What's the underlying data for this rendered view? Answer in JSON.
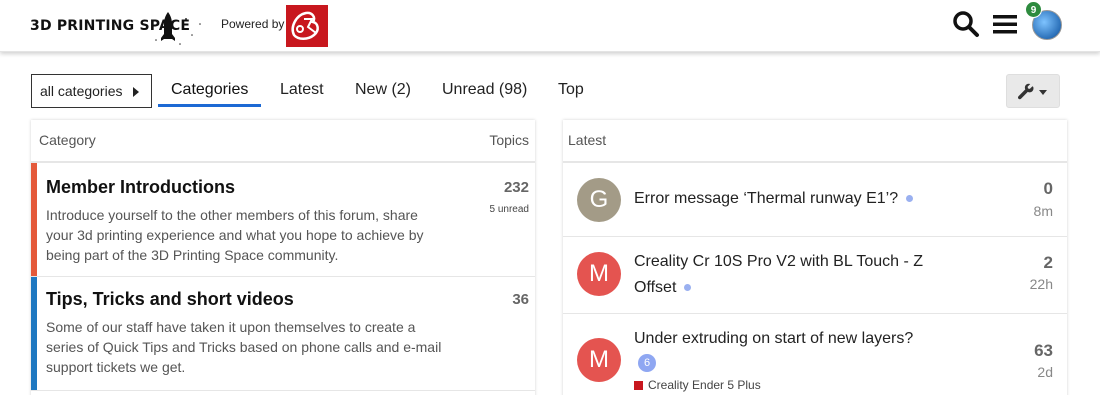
{
  "header": {
    "logo_text": "3D PRINTING SPACE",
    "powered_by": "Powered by",
    "notification_count": "9",
    "icons": [
      "search-icon",
      "hamburger-menu-icon",
      "user-avatar"
    ]
  },
  "nav": {
    "category_dropdown": "all categories",
    "tabs": [
      {
        "label": "Categories",
        "active": true
      },
      {
        "label": "Latest"
      },
      {
        "label": "New (2)"
      },
      {
        "label": "Unread (98)"
      },
      {
        "label": "Top"
      }
    ],
    "tools_button_icon": "wrench-icon"
  },
  "categories_panel": {
    "header_category": "Category",
    "header_topics": "Topics",
    "rows": [
      {
        "title": "Member Introductions",
        "description": "Introduce yourself to the other members of this forum, share your 3d printing experience and what you hope to achieve by being part of the 3D Printing Space community.",
        "topics": "232",
        "unread": "5 unread",
        "color": "#e4593a"
      },
      {
        "title": "Tips, Tricks and short videos",
        "description": "Some of our staff have taken it upon themselves to create a series of Quick Tips and Tricks based on phone calls and e-mail support tickets we get.",
        "topics": "36",
        "color": "#1f78c1"
      }
    ]
  },
  "latest_panel": {
    "header": "Latest",
    "topics": [
      {
        "avatar_letter": "G",
        "avatar_color": "#a39b87",
        "title": "Error message ‘Thermal runway E1’?",
        "replies": "0",
        "age": "8m"
      },
      {
        "avatar_letter": "M",
        "avatar_color": "#e45450",
        "title": "Creality Cr 10S Pro V2 with BL Touch - Z Offset",
        "replies": "2",
        "age": "22h"
      },
      {
        "avatar_letter": "M",
        "avatar_color": "#e45450",
        "title": "Under extruding on start of new layers?",
        "new_posts": "6",
        "category": "Creality Ender 5 Plus",
        "category_color": "#c8171e",
        "replies": "63",
        "age": "2d"
      }
    ]
  }
}
